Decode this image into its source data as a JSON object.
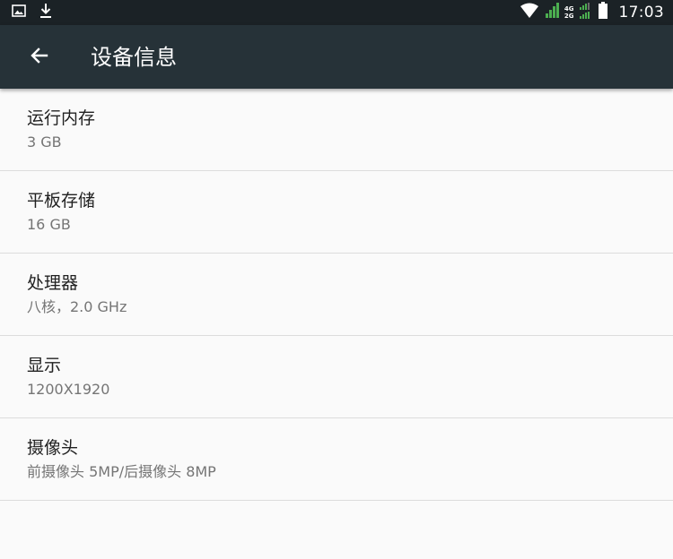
{
  "status_bar": {
    "time": "17:03",
    "network_top": "4G",
    "network_bottom": "2G",
    "left_icons": [
      "image-icon",
      "download-icon"
    ],
    "right_icons": [
      "wifi-icon",
      "signal-icon",
      "battery-icon"
    ],
    "signal_color": "#4caf50"
  },
  "app_bar": {
    "title": "设备信息",
    "back_icon": "back-arrow-icon",
    "background": "#263238"
  },
  "items": [
    {
      "title": "运行内存",
      "value": "3 GB"
    },
    {
      "title": "平板存储",
      "value": "16 GB"
    },
    {
      "title": "处理器",
      "value": "八核，2.0 GHz"
    },
    {
      "title": "显示",
      "value": "1200X1920"
    },
    {
      "title": "摄像头",
      "value": "前摄像头 5MP/后摄像头 8MP"
    }
  ]
}
